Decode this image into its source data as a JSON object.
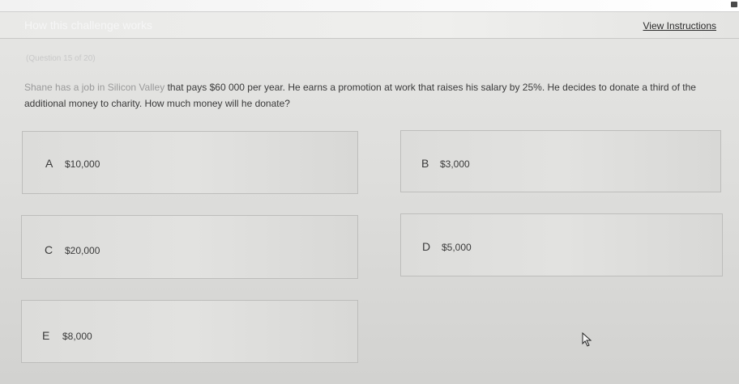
{
  "header": {
    "title": "How this challenge works",
    "view_instructions": "View Instructions"
  },
  "question": {
    "number_label": "(Question 15 of 20)",
    "text_faded": "Shane has a job in Silicon Valley",
    "text_main": " that pays $60 000 per year. He earns a promotion at work that raises his salary by 25%. He decides to donate a third of the additional money to charity. How much money will he donate?"
  },
  "options": [
    {
      "letter": "A",
      "value": "$10,000"
    },
    {
      "letter": "B",
      "value": "$3,000"
    },
    {
      "letter": "C",
      "value": "$20,000"
    },
    {
      "letter": "D",
      "value": "$5,000"
    },
    {
      "letter": "E",
      "value": "$8,000"
    }
  ]
}
